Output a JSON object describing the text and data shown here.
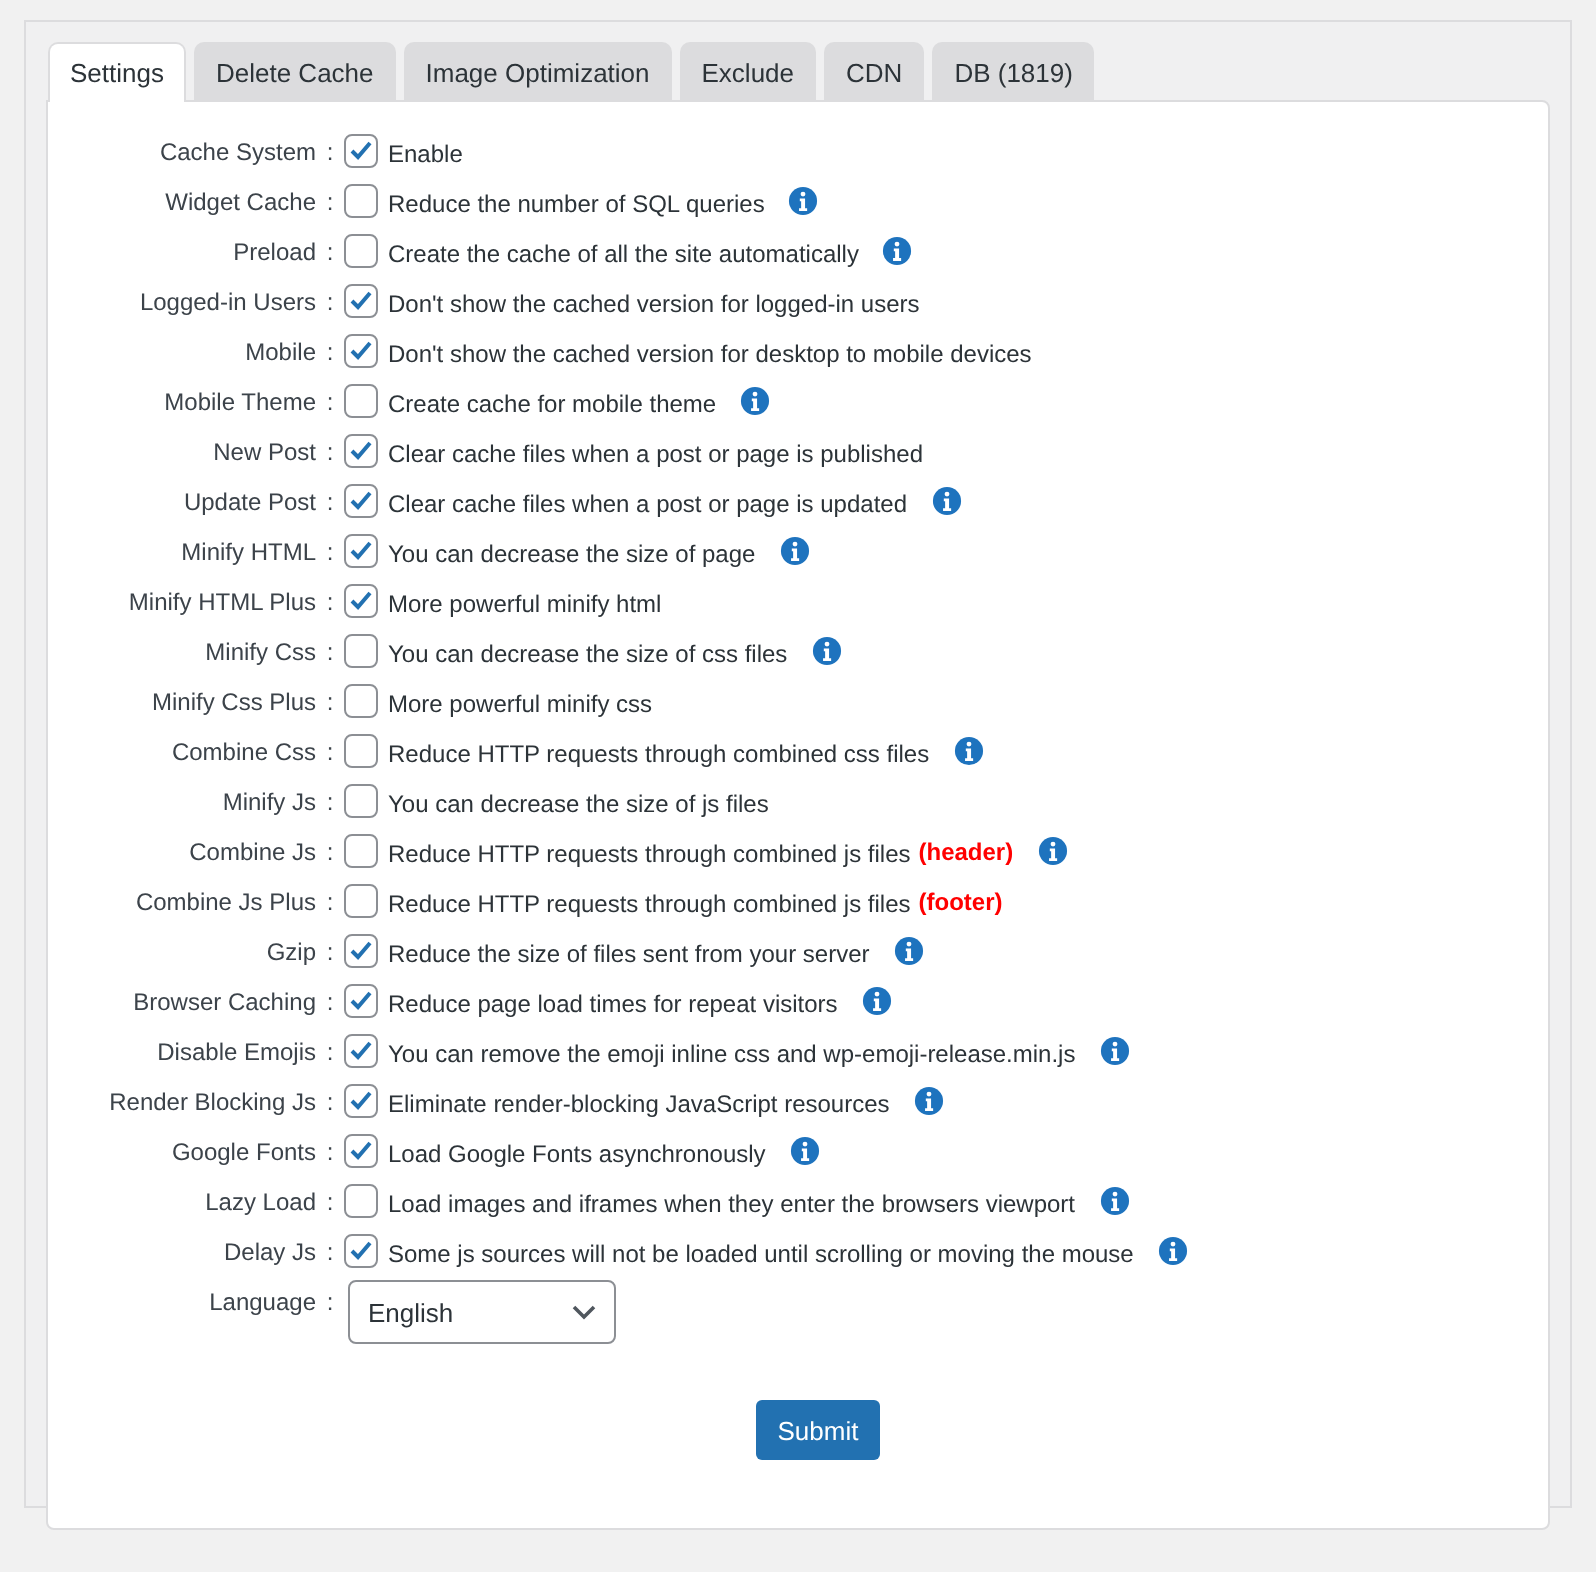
{
  "tabs": [
    {
      "label": "Settings",
      "selected": true
    },
    {
      "label": "Delete Cache",
      "selected": false
    },
    {
      "label": "Image Optimization",
      "selected": false
    },
    {
      "label": "Exclude",
      "selected": false
    },
    {
      "label": "CDN",
      "selected": false
    },
    {
      "label": "DB (1819)",
      "selected": false
    }
  ],
  "settings": [
    {
      "label": "Cache System",
      "separator": ":",
      "checked": true,
      "text": "Enable",
      "info": false
    },
    {
      "label": "Widget Cache",
      "separator": ":",
      "checked": false,
      "text": "Reduce the number of SQL queries",
      "info": true
    },
    {
      "label": "Preload",
      "separator": ":",
      "checked": false,
      "text": "Create the cache of all the site automatically",
      "info": true
    },
    {
      "label": "Logged-in Users",
      "separator": ":",
      "checked": true,
      "text": "Don't show the cached version for logged-in users",
      "info": false
    },
    {
      "label": "Mobile",
      "separator": ":",
      "checked": true,
      "text": "Don't show the cached version for desktop to mobile devices",
      "info": false
    },
    {
      "label": "Mobile Theme",
      "separator": ":",
      "checked": false,
      "text": "Create cache for mobile theme",
      "info": true
    },
    {
      "label": "New Post",
      "separator": ":",
      "checked": true,
      "text": "Clear cache files when a post or page is published",
      "info": false
    },
    {
      "label": "Update Post",
      "separator": ":",
      "checked": true,
      "text": "Clear cache files when a post or page is updated",
      "info": true
    },
    {
      "label": "Minify HTML",
      "separator": ":",
      "checked": true,
      "text": "You can decrease the size of page",
      "info": true
    },
    {
      "label": "Minify HTML Plus",
      "separator": ":",
      "checked": true,
      "text": "More powerful minify html",
      "info": false
    },
    {
      "label": "Minify Css",
      "separator": ":",
      "checked": false,
      "text": "You can decrease the size of css files",
      "info": true
    },
    {
      "label": "Minify Css Plus",
      "separator": ":",
      "checked": false,
      "text": "More powerful minify css",
      "info": false
    },
    {
      "label": "Combine Css",
      "separator": ":",
      "checked": false,
      "text": "Reduce HTTP requests through combined css files",
      "info": true
    },
    {
      "label": "Minify Js",
      "separator": ":",
      "checked": false,
      "text": "You can decrease the size of js files",
      "info": false
    },
    {
      "label": "Combine Js",
      "separator": ":",
      "checked": false,
      "text": "Reduce HTTP requests through combined js files",
      "note": "(header)",
      "info": true
    },
    {
      "label": "Combine Js Plus",
      "separator": ":",
      "checked": false,
      "text": "Reduce HTTP requests through combined js files",
      "note": "(footer)",
      "info": false
    },
    {
      "label": "Gzip",
      "separator": ":",
      "checked": true,
      "text": "Reduce the size of files sent from your server",
      "info": true
    },
    {
      "label": "Browser Caching",
      "separator": ":",
      "checked": true,
      "text": "Reduce page load times for repeat visitors",
      "info": true
    },
    {
      "label": "Disable Emojis",
      "separator": ":",
      "checked": true,
      "text": "You can remove the emoji inline css and wp-emoji-release.min.js",
      "info": true
    },
    {
      "label": "Render Blocking Js",
      "separator": ":",
      "checked": true,
      "text": "Eliminate render-blocking JavaScript resources",
      "info": true
    },
    {
      "label": "Google Fonts",
      "separator": ":",
      "checked": true,
      "text": "Load Google Fonts asynchronously",
      "info": true
    },
    {
      "label": "Lazy Load",
      "separator": ":",
      "checked": false,
      "text": "Load images and iframes when they enter the browsers viewport",
      "info": true
    },
    {
      "label": "Delay Js",
      "separator": ":",
      "checked": true,
      "text": "Some js sources will not be loaded until scrolling or moving the mouse",
      "info": true
    }
  ],
  "language": {
    "label": "Language",
    "separator": ":",
    "value": "English"
  },
  "submit": "Submit"
}
